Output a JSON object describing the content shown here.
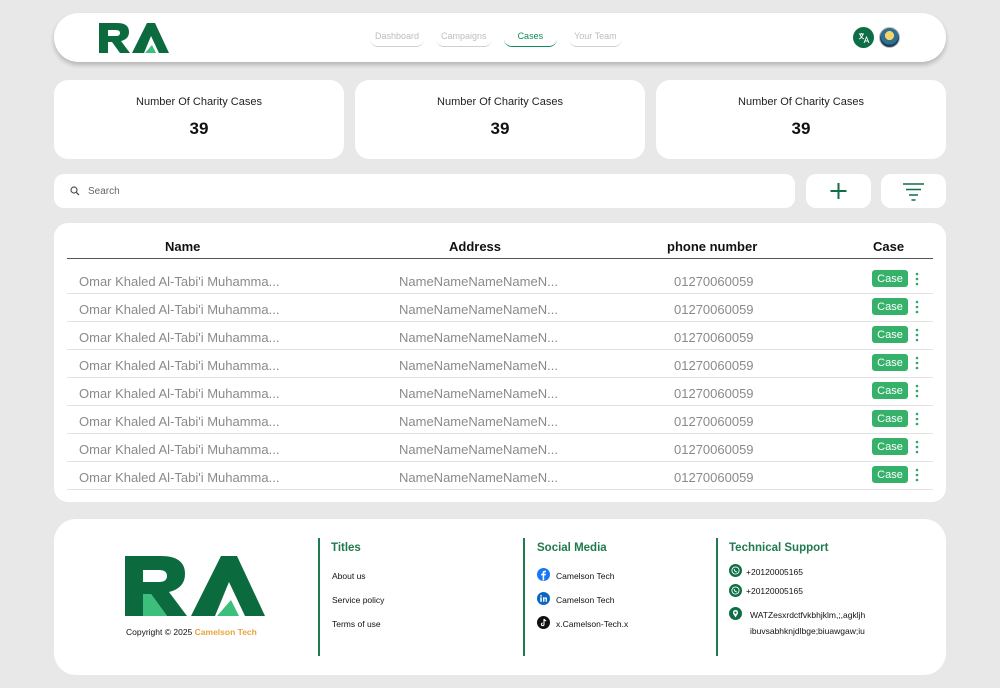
{
  "header": {
    "logo_text": "RA",
    "nav": [
      {
        "label": "Dashboard",
        "active": false
      },
      {
        "label": "Campaigns",
        "active": false
      },
      {
        "label": "Cases",
        "active": true
      },
      {
        "label": "Your Team",
        "active": false
      }
    ],
    "lang_icon": "translate-icon",
    "accent": "#0f8a5a"
  },
  "stats": [
    {
      "label": "Number Of Charity Cases",
      "value": "39"
    },
    {
      "label": "Number Of Charity Cases",
      "value": "39"
    },
    {
      "label": "Number Of Charity Cases",
      "value": "39"
    }
  ],
  "search": {
    "placeholder": "Search"
  },
  "table": {
    "headers": [
      "Name",
      "Address",
      "phone number",
      "Case"
    ],
    "rows": [
      {
        "name": "Omar Khaled Al-Tabi'i Muhamma...",
        "address": "NameNameNameNameN...",
        "phone": "01270060059",
        "case": "Case"
      },
      {
        "name": "Omar Khaled Al-Tabi'i Muhamma...",
        "address": "NameNameNameNameN...",
        "phone": "01270060059",
        "case": "Case"
      },
      {
        "name": "Omar Khaled Al-Tabi'i Muhamma...",
        "address": "NameNameNameNameN...",
        "phone": "01270060059",
        "case": "Case"
      },
      {
        "name": "Omar Khaled Al-Tabi'i Muhamma...",
        "address": "NameNameNameNameN...",
        "phone": "01270060059",
        "case": "Case"
      },
      {
        "name": "Omar Khaled Al-Tabi'i Muhamma...",
        "address": "NameNameNameNameN...",
        "phone": "01270060059",
        "case": "Case"
      },
      {
        "name": "Omar Khaled Al-Tabi'i Muhamma...",
        "address": "NameNameNameNameN...",
        "phone": "01270060059",
        "case": "Case"
      },
      {
        "name": "Omar Khaled Al-Tabi'i Muhamma...",
        "address": "NameNameNameNameN...",
        "phone": "01270060059",
        "case": "Case"
      },
      {
        "name": "Omar Khaled Al-Tabi'i Muhamma...",
        "address": "NameNameNameNameN...",
        "phone": "01270060059",
        "case": "Case"
      }
    ]
  },
  "footer": {
    "copyright_prefix": "Copyright © 2025 ",
    "copyright_brand": "Camelson Tech",
    "titles_heading": "Titles",
    "titles": [
      "About us",
      "Service policy",
      "Terms of use"
    ],
    "social_heading": "Social Media",
    "social": [
      {
        "label": "Camelson Tech",
        "icon": "facebook-icon"
      },
      {
        "label": "Camelson Tech",
        "icon": "linkedin-icon"
      },
      {
        "label": "x.Camelson-Tech.x",
        "icon": "tiktok-icon"
      }
    ],
    "support_heading": "Technical Support",
    "phones": [
      "+20120005165",
      "+20120005165"
    ],
    "address_lines": [
      "WATZesxrdctfvkbhjklm,;,agkljh",
      "ibuvsabhknjdlbge;biuawgaw;iu"
    ]
  }
}
